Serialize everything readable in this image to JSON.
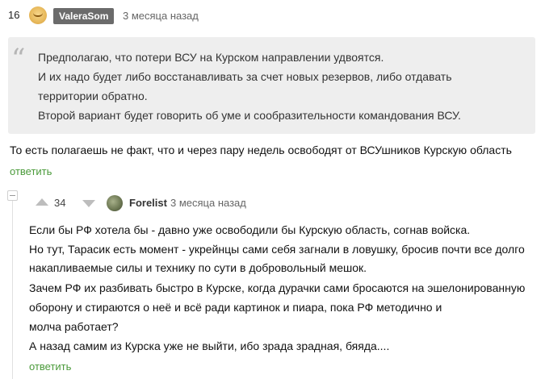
{
  "comment1": {
    "rating": "16",
    "author": "ValeraSom",
    "time": "3 месяца назад",
    "quote_lines": [
      "Предполагаю, что потери ВСУ на Курском направлении удвоятся.",
      "И их надо будет либо восстанавливать за счет новых резервов, либо отдавать",
      "территории обратно.",
      "Второй вариант будет говорить об уме и сообразительности командования ВСУ."
    ],
    "text": "То есть полагаешь не факт, что и через пару недель освободят от ВСУшников Курскую область",
    "reply_label": "ответить"
  },
  "comment2": {
    "votes": "34",
    "author": "Forelist",
    "time": "3 месяца назад",
    "lines": [
      "Если бы РФ хотела бы - давно уже освободили бы Курскую область, согнав войска.",
      "Но тут, Тарасик есть момент - укрейнцы сами себя загнали в ловушку, бросив почти все долго",
      "накапливаемые силы и технику по сути в добровольный мешок.",
      "Зачем РФ их разбивать быстро в Курске, когда дурачки сами бросаются на эшелонированную",
      "оборону и стираются о неё и всё ради картинок и пиара, пока РФ методично и",
      "молча работает?",
      "А назад самим из Курска уже не выйти, ибо зрада зрадная, бяяда...."
    ],
    "reply_label": "ответить"
  },
  "icons": {
    "quote": "“",
    "avatar1": "smiley-avatar-icon",
    "avatar2": "user-avatar-icon",
    "upvote": "arrow-up-icon",
    "downvote": "arrow-down-icon",
    "collapse": "collapse-thread-icon"
  },
  "colors": {
    "reply_link": "#4a9a3a",
    "author_badge_bg": "#6b6b6b",
    "quote_bg": "#eeeeee"
  }
}
